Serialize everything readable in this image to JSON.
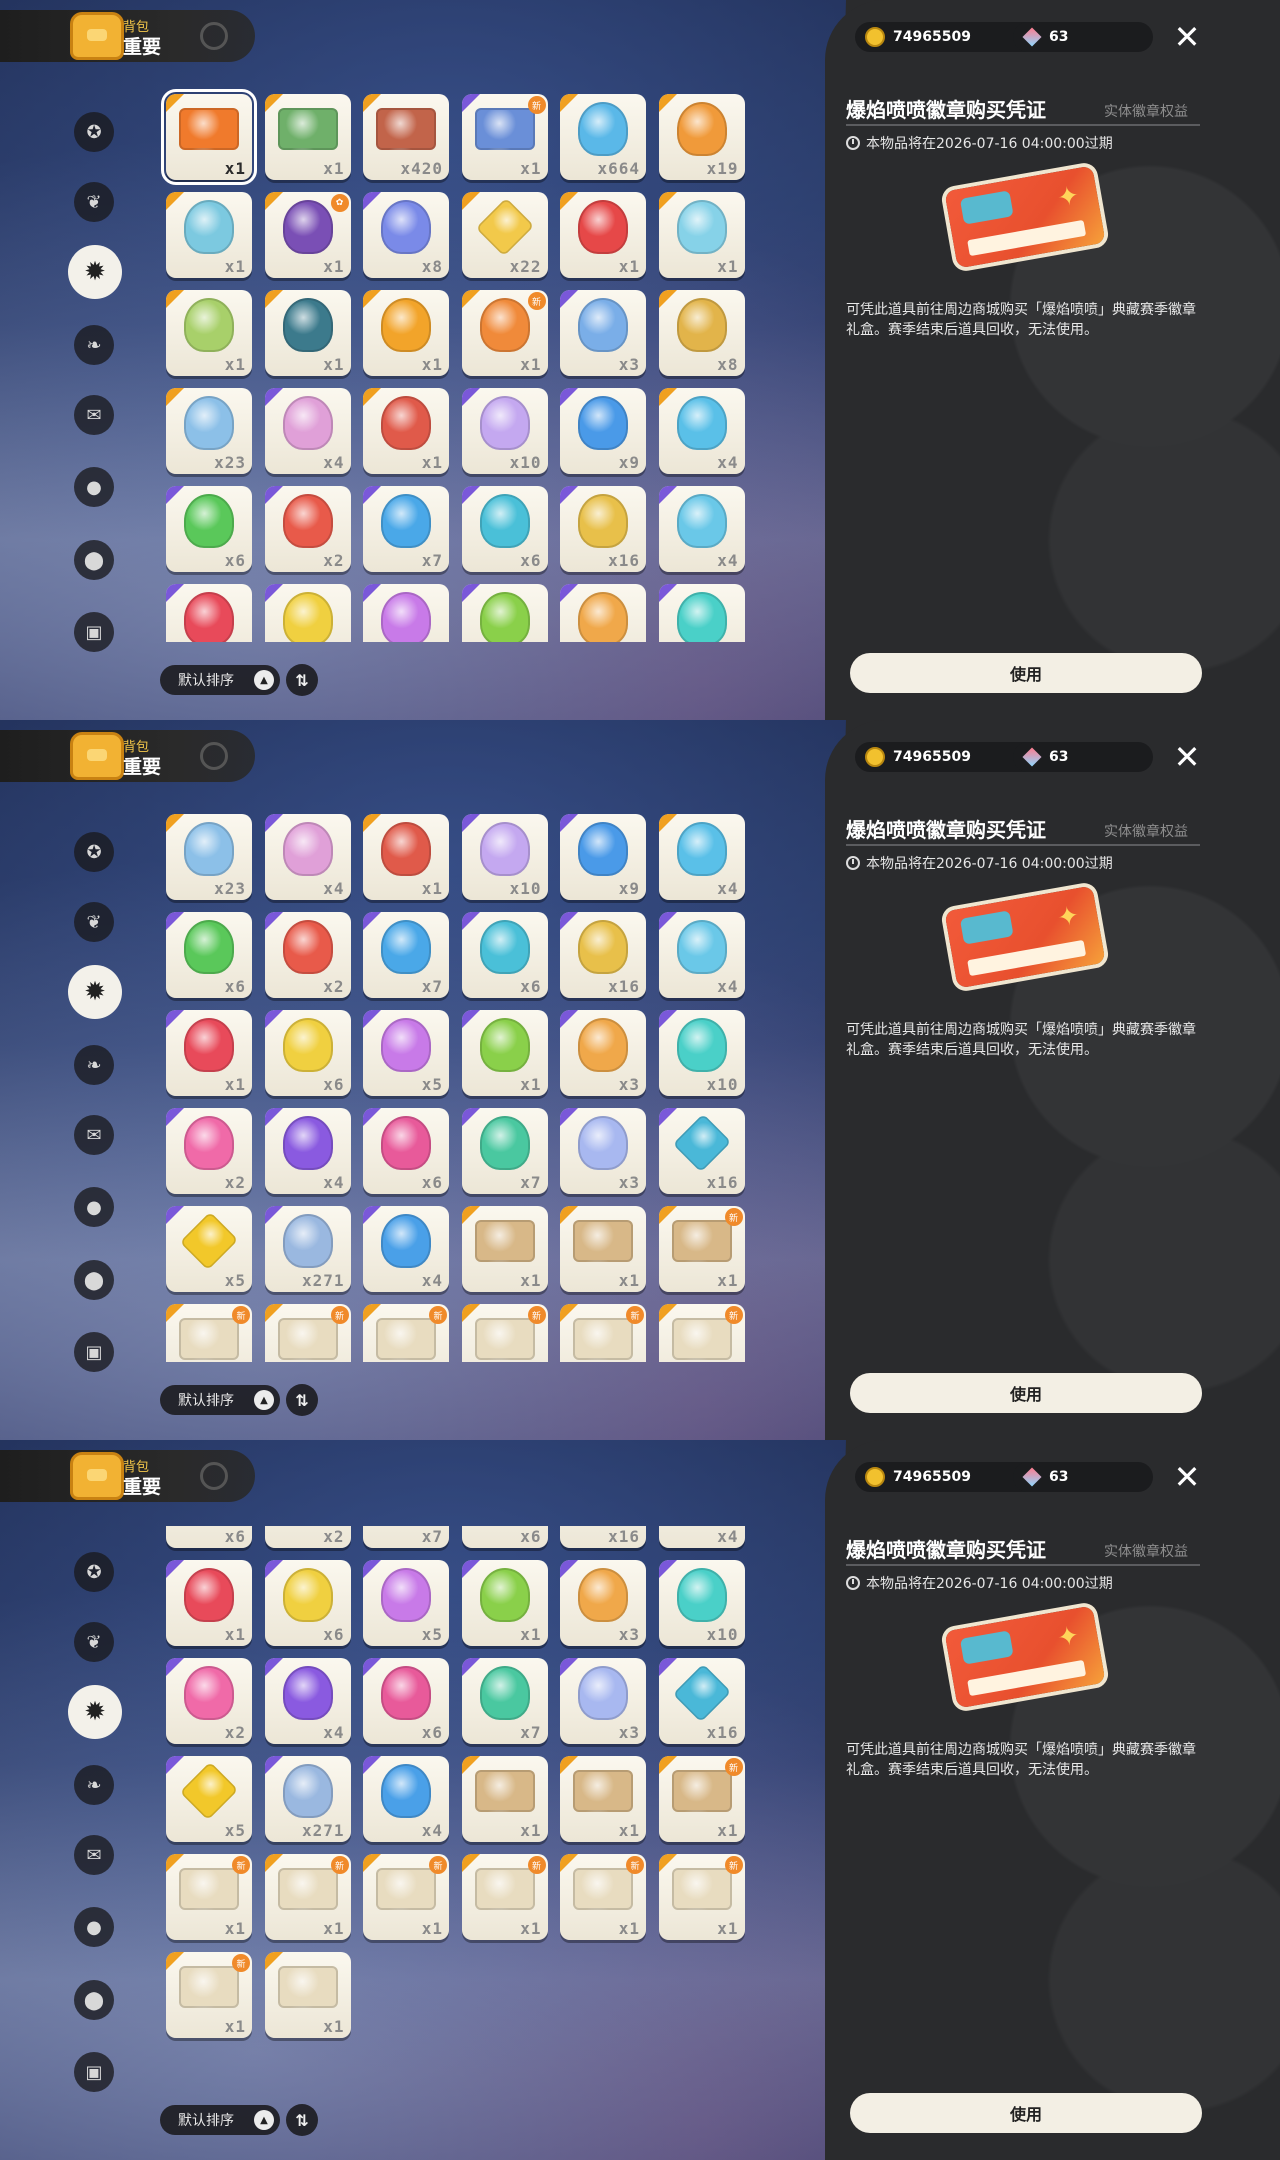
{
  "header": {
    "title": "背包",
    "subtitle": "重要"
  },
  "currency": {
    "gold": "74965509",
    "gems": "63"
  },
  "detail": {
    "name": "爆焰喷喷徽章购买凭证",
    "tag": "实体徽章权益",
    "expiry": "本物品将在2026-07-16 04:00:00过期",
    "description": "可凭此道具前往周边商城购买「爆焰喷喷」典藏赛季徽章礼盒。赛季结束后道具回收，无法使用。",
    "use_label": "使用"
  },
  "sort": {
    "label": "默认排序",
    "order_icon": "⇅"
  },
  "categories": [
    {
      "icon": "star-badge-icon",
      "glyph": "✪"
    },
    {
      "icon": "leaf-icon",
      "glyph": "❦"
    },
    {
      "icon": "gear-badge-icon",
      "glyph": "✹"
    },
    {
      "icon": "sprout-icon",
      "glyph": "❧"
    },
    {
      "icon": "scroll-icon",
      "glyph": "✉"
    },
    {
      "icon": "ball-icon",
      "glyph": "●"
    },
    {
      "icon": "acorn-icon",
      "glyph": "⬤"
    },
    {
      "icon": "chest-icon",
      "glyph": "▣"
    }
  ],
  "items": [
    {
      "count": "x1",
      "color": "#f07a2c",
      "rarity": "#f0a020",
      "shape": "card",
      "new": "",
      "selected": true
    },
    {
      "count": "x1",
      "color": "#6fb06a",
      "rarity": "#f0a020",
      "shape": "card",
      "new": ""
    },
    {
      "count": "x420",
      "color": "#c2644a",
      "rarity": "#f0a020",
      "shape": "card",
      "new": ""
    },
    {
      "count": "x1",
      "color": "#6a8fd8",
      "rarity": "#7a58d9",
      "shape": "card",
      "new": "新"
    },
    {
      "count": "x664",
      "color": "#5ab8e8",
      "rarity": "#f0a020",
      "shape": "gem",
      "new": ""
    },
    {
      "count": "x19",
      "color": "#f09a3a",
      "rarity": "#f0a020",
      "shape": "orb",
      "new": ""
    },
    {
      "count": "x1",
      "color": "#7cc9e0",
      "rarity": "#f0a020",
      "shape": "orb",
      "new": ""
    },
    {
      "count": "x1",
      "color": "#7a4fb5",
      "rarity": "#f0a020",
      "shape": "orb",
      "new": "✿"
    },
    {
      "count": "x8",
      "color": "#7a8ae8",
      "rarity": "#7a58d9",
      "shape": "gem",
      "new": ""
    },
    {
      "count": "x22",
      "color": "#f2c94a",
      "rarity": "#f0a020",
      "shape": "star",
      "new": ""
    },
    {
      "count": "x1",
      "color": "#e64848",
      "rarity": "#f0a020",
      "shape": "gem",
      "new": ""
    },
    {
      "count": "x1",
      "color": "#86d2e8",
      "rarity": "#f0a020",
      "shape": "orb",
      "new": ""
    },
    {
      "count": "x1",
      "color": "#a8d06a",
      "rarity": "#f0a020",
      "shape": "orb",
      "new": ""
    },
    {
      "count": "x1",
      "color": "#3c7a8c",
      "rarity": "#f0a020",
      "shape": "orb",
      "new": ""
    },
    {
      "count": "x1",
      "color": "#f2a42a",
      "rarity": "#f0a020",
      "shape": "orb",
      "new": ""
    },
    {
      "count": "x1",
      "color": "#f08a3a",
      "rarity": "#f0a020",
      "shape": "orb",
      "new": "新"
    },
    {
      "count": "x3",
      "color": "#7aaee8",
      "rarity": "#7a58d9",
      "shape": "orb",
      "new": ""
    },
    {
      "count": "x8",
      "color": "#e2b44a",
      "rarity": "#f0a020",
      "shape": "orb",
      "new": ""
    },
    {
      "count": "x23",
      "color": "#8cc0e8",
      "rarity": "#f0a020",
      "shape": "orb",
      "new": ""
    },
    {
      "count": "x4",
      "color": "#e0a0d8",
      "rarity": "#7a58d9",
      "shape": "orb",
      "new": ""
    },
    {
      "count": "x1",
      "color": "#e05a4a",
      "rarity": "#f0a020",
      "shape": "orb",
      "new": ""
    },
    {
      "count": "x10",
      "color": "#c4a8f0",
      "rarity": "#7a58d9",
      "shape": "gem",
      "new": ""
    },
    {
      "count": "x9",
      "color": "#4a9ae8",
      "rarity": "#7a58d9",
      "shape": "orb",
      "new": ""
    },
    {
      "count": "x4",
      "color": "#5ac0e8",
      "rarity": "#f0a020",
      "shape": "orb",
      "new": ""
    },
    {
      "count": "x6",
      "color": "#5ac85a",
      "rarity": "#7a58d9",
      "shape": "orb",
      "new": ""
    },
    {
      "count": "x2",
      "color": "#e85a4a",
      "rarity": "#7a58d9",
      "shape": "orb",
      "new": ""
    },
    {
      "count": "x7",
      "color": "#4aa8e8",
      "rarity": "#7a58d9",
      "shape": "orb",
      "new": ""
    },
    {
      "count": "x6",
      "color": "#4ac0d8",
      "rarity": "#7a58d9",
      "shape": "orb",
      "new": ""
    },
    {
      "count": "x16",
      "color": "#e8c04a",
      "rarity": "#7a58d9",
      "shape": "orb",
      "new": ""
    },
    {
      "count": "x4",
      "color": "#6ac8e8",
      "rarity": "#7a58d9",
      "shape": "orb",
      "new": ""
    },
    {
      "count": "x1",
      "color": "#e84a5a",
      "rarity": "#7a58d9",
      "shape": "orb",
      "new": ""
    },
    {
      "count": "x6",
      "color": "#f0d040",
      "rarity": "#7a58d9",
      "shape": "orb",
      "new": ""
    },
    {
      "count": "x5",
      "color": "#c87ae8",
      "rarity": "#7a58d9",
      "shape": "orb",
      "new": ""
    },
    {
      "count": "x1",
      "color": "#8ad04a",
      "rarity": "#7a58d9",
      "shape": "orb",
      "new": ""
    },
    {
      "count": "x3",
      "color": "#f0a84a",
      "rarity": "#7a58d9",
      "shape": "orb",
      "new": ""
    },
    {
      "count": "x10",
      "color": "#4ad0c8",
      "rarity": "#7a58d9",
      "shape": "orb",
      "new": ""
    },
    {
      "count": "x2",
      "color": "#f06aa8",
      "rarity": "#7a58d9",
      "shape": "orb",
      "new": ""
    },
    {
      "count": "x4",
      "color": "#8a5ae0",
      "rarity": "#7a58d9",
      "shape": "orb",
      "new": ""
    },
    {
      "count": "x6",
      "color": "#e85a9a",
      "rarity": "#7a58d9",
      "shape": "orb",
      "new": ""
    },
    {
      "count": "x7",
      "color": "#4ac8a0",
      "rarity": "#7a58d9",
      "shape": "orb",
      "new": ""
    },
    {
      "count": "x3",
      "color": "#a8b8f0",
      "rarity": "#7a58d9",
      "shape": "orb",
      "new": ""
    },
    {
      "count": "x16",
      "color": "#4ab8d8",
      "rarity": "#7a58d9",
      "shape": "star",
      "new": ""
    },
    {
      "count": "x5",
      "color": "#f2c82a",
      "rarity": "#7a58d9",
      "shape": "star",
      "new": ""
    },
    {
      "count": "x271",
      "color": "#9ab8e0",
      "rarity": "#7a58d9",
      "shape": "orb",
      "new": ""
    },
    {
      "count": "x4",
      "color": "#4aa0e8",
      "rarity": "#7a58d9",
      "shape": "orb",
      "new": ""
    },
    {
      "count": "x1",
      "color": "#d8b888",
      "rarity": "#f0a020",
      "shape": "card",
      "new": ""
    },
    {
      "count": "x1",
      "color": "#d8b888",
      "rarity": "#f0a020",
      "shape": "card",
      "new": ""
    },
    {
      "count": "x1",
      "color": "#d8b888",
      "rarity": "#f0a020",
      "shape": "card",
      "new": "新"
    },
    {
      "count": "x1",
      "color": "#e8dcc0",
      "rarity": "#f0a020",
      "shape": "card",
      "new": "新"
    },
    {
      "count": "x1",
      "color": "#e8dcc0",
      "rarity": "#f0a020",
      "shape": "card",
      "new": "新"
    },
    {
      "count": "x1",
      "color": "#e8dcc0",
      "rarity": "#f0a020",
      "shape": "card",
      "new": "新"
    },
    {
      "count": "x1",
      "color": "#e8dcc0",
      "rarity": "#f0a020",
      "shape": "card",
      "new": "新"
    },
    {
      "count": "x1",
      "color": "#e8dcc0",
      "rarity": "#f0a020",
      "shape": "card",
      "new": "新"
    },
    {
      "count": "x1",
      "color": "#e8dcc0",
      "rarity": "#f0a020",
      "shape": "card",
      "new": "新"
    },
    {
      "count": "x1",
      "color": "#e8dcc0",
      "rarity": "#f0a020",
      "shape": "card",
      "new": "新"
    },
    {
      "count": "x1",
      "color": "#e8dcc0",
      "rarity": "#f0a020",
      "shape": "card",
      "new": ""
    }
  ],
  "panels": [
    {
      "scroll_rows": 0,
      "visible_rows": 6
    },
    {
      "scroll_rows": 3,
      "visible_rows": 6
    },
    {
      "scroll_rows": 4.73,
      "visible_rows": 6
    }
  ]
}
